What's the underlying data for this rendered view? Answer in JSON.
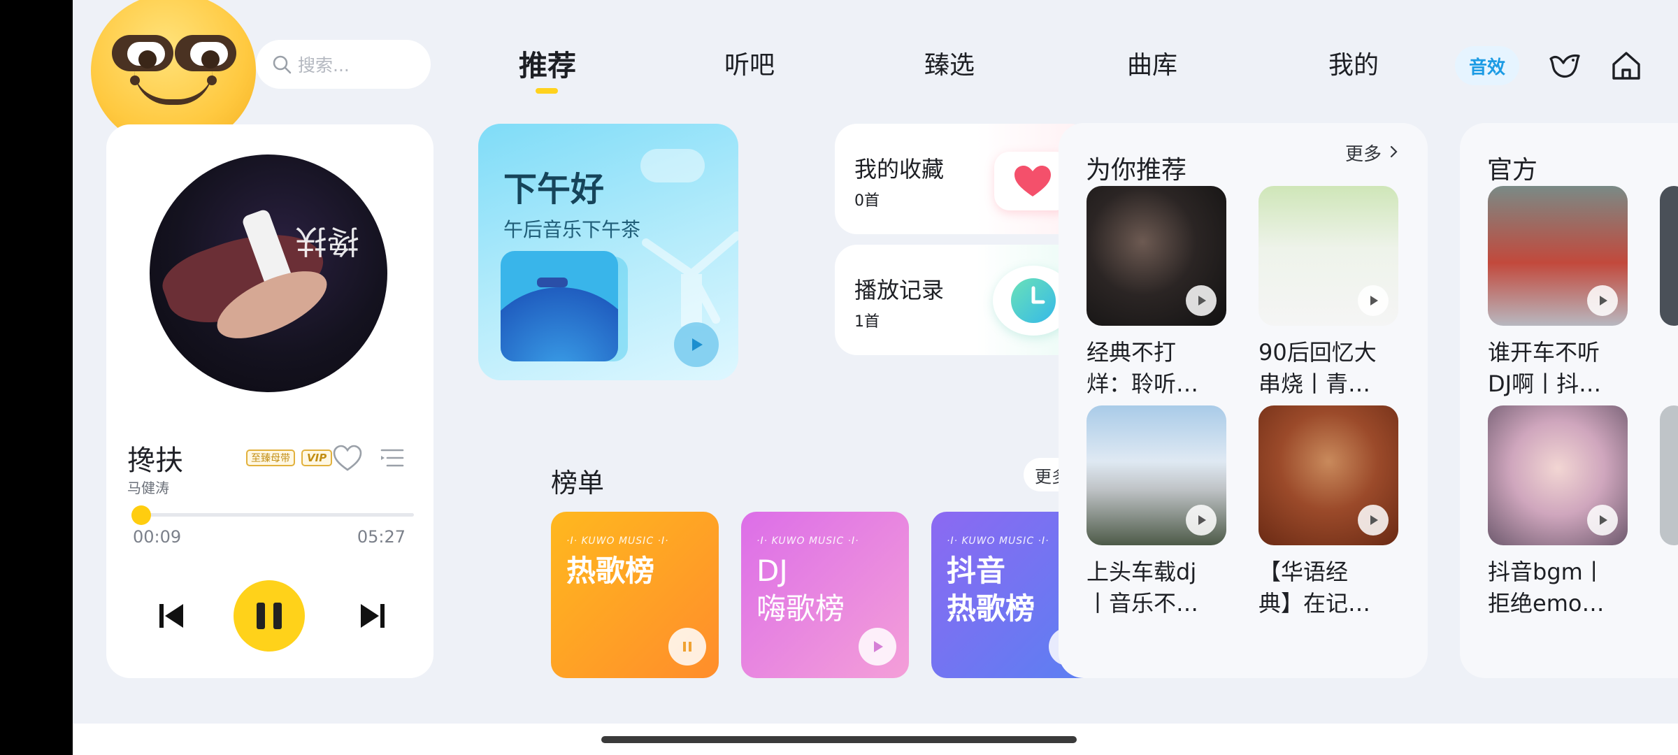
{
  "search": {
    "placeholder": "搜索..."
  },
  "tabs": [
    {
      "label": "推荐",
      "active": true
    },
    {
      "label": "听吧"
    },
    {
      "label": "臻选"
    },
    {
      "label": "曲库"
    },
    {
      "label": "我的"
    }
  ],
  "header": {
    "sound_effect": "音效",
    "icons": [
      "bird-icon",
      "home-icon"
    ]
  },
  "player": {
    "song_title": "搀扶",
    "artist": "马健涛",
    "badge_master": "至臻母带",
    "badge_vip": "VIP",
    "current_time": "00:09",
    "total_time": "05:27",
    "progress_fraction": 0.03,
    "state": "playing"
  },
  "greeting": {
    "title": "下午好",
    "subtitle": "午后音乐下午茶"
  },
  "favorites": {
    "title": "我的收藏",
    "count": "0首"
  },
  "history": {
    "title": "播放记录",
    "count": "1首"
  },
  "charts": {
    "heading": "榜单",
    "more": "更多",
    "brand": "·I· KUWO MUSIC ·I·",
    "items": [
      {
        "name": "热歌榜",
        "color_from": "#ffb21e",
        "color_to": "#ff8a2a"
      },
      {
        "name": "DJ\n嗨歌榜",
        "color_from": "#e27be8",
        "color_to": "#f29ad9"
      },
      {
        "name": "抖音\n热歌榜",
        "color_from": "#8f6cf3",
        "color_to": "#5b7ff2"
      }
    ]
  },
  "recommend": {
    "title": "为你推荐",
    "more": "更多",
    "items": [
      {
        "caption": "经典不打\n烊：聆听…"
      },
      {
        "caption": "90后回忆大\n串烧丨青…"
      },
      {
        "caption": "上头车载dj\n丨音乐不…"
      },
      {
        "caption": "【华语经\n典】在记…"
      }
    ]
  },
  "official": {
    "title": "官方",
    "items": [
      {
        "caption": "谁开车不听\nDJ啊丨抖…"
      },
      {
        "caption": "抖音bgm丨\n拒绝emo…"
      }
    ]
  },
  "colors": {
    "accent": "#ffd21e",
    "sound_effect": "#1c9be4",
    "background": "#eef1f7"
  }
}
